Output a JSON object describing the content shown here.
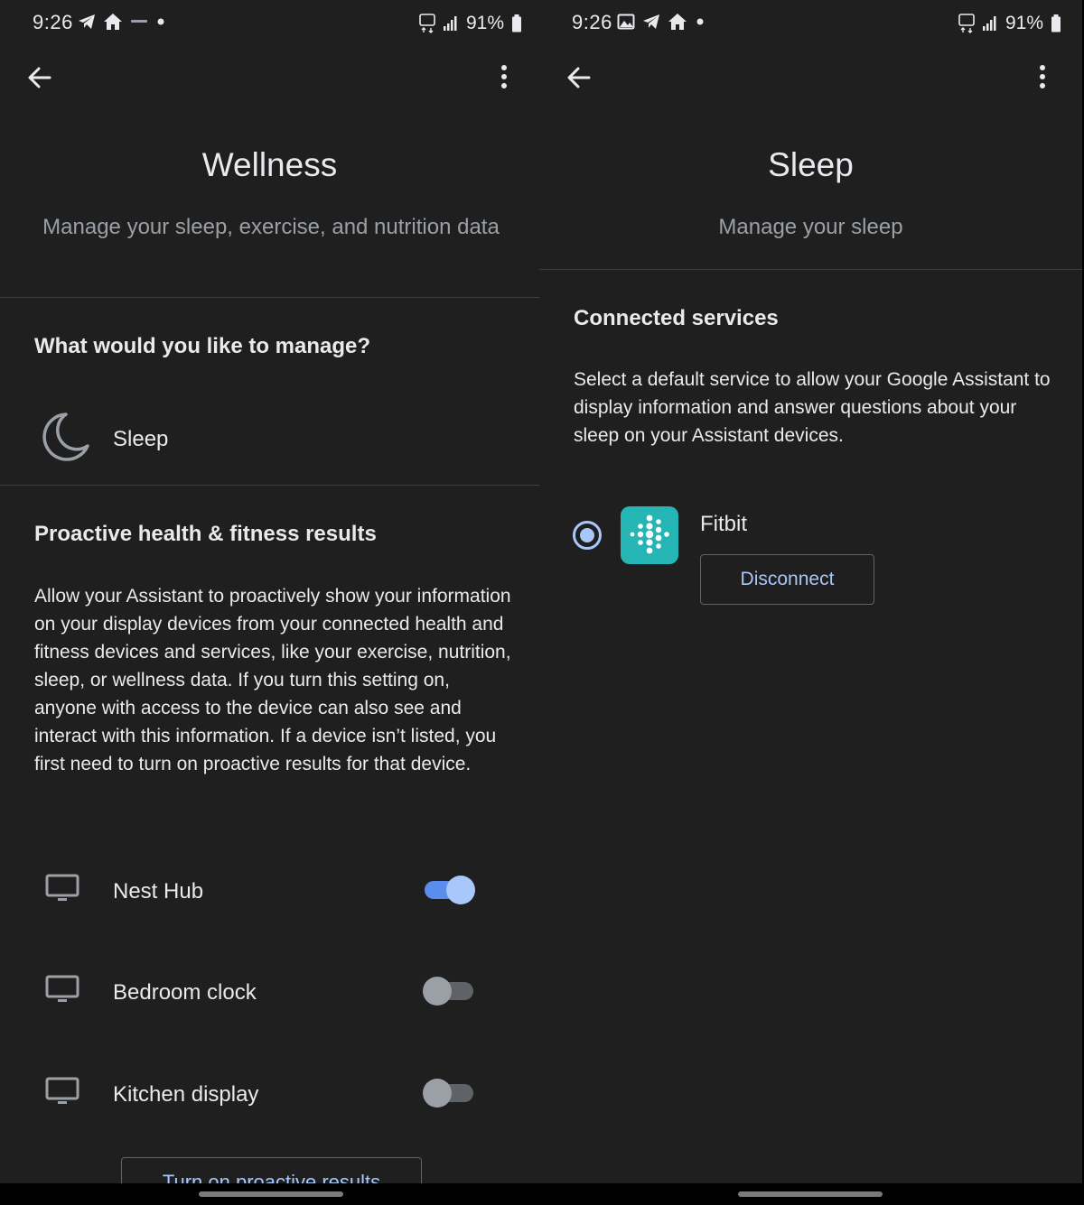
{
  "left": {
    "status": {
      "time": "9:26",
      "battery": "91%"
    },
    "title": "Wellness",
    "subtitle": "Manage your sleep, exercise, and nutrition data",
    "manage_heading": "What would you like to manage?",
    "sleep_item": {
      "label": "Sleep",
      "icon": "moon-icon"
    },
    "proactive_heading": "Proactive health & fitness results",
    "proactive_body": "Allow your Assistant to proactively show your information on your display devices from your connected health and fitness devices and services, like your exercise, nutrition, sleep, or wellness data. If you turn this setting on, anyone with access to the device can also see and interact with this information. If a device isn’t listed, you first need to turn on proactive results for that device.",
    "devices": [
      {
        "label": "Nest Hub",
        "enabled": true,
        "icon": "display-icon"
      },
      {
        "label": "Bedroom clock",
        "enabled": false,
        "icon": "display-icon"
      },
      {
        "label": "Kitchen display",
        "enabled": false,
        "icon": "display-icon"
      }
    ],
    "bottom_button": "Turn on proactive results"
  },
  "right": {
    "status": {
      "time": "9:26",
      "battery": "91%"
    },
    "title": "Sleep",
    "subtitle": "Manage your sleep",
    "connected_heading": "Connected services",
    "connected_body": "Select a default service to allow your Google Assistant to display information and answer questions about your sleep on your Assistant devices.",
    "service": {
      "name": "Fitbit",
      "selected": true,
      "action": "Disconnect",
      "icon": "fitbit-icon"
    }
  },
  "colors": {
    "background": "#1f1f1f",
    "accent": "#a8c7fa",
    "toggle_on": "#5b8def",
    "fitbit_teal": "#26b5b5",
    "secondary_text": "#9aa0a6"
  }
}
